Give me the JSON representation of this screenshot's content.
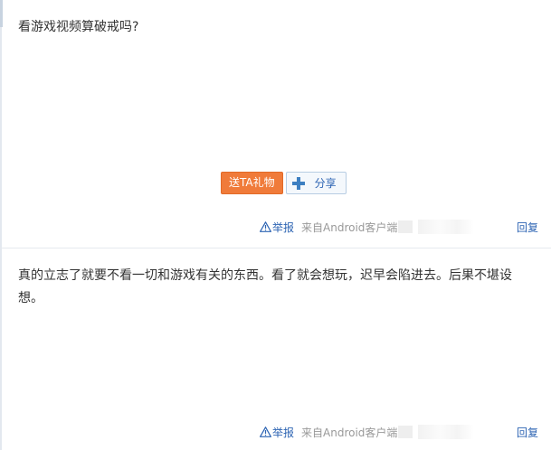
{
  "posts": [
    {
      "content": "看游戏视频算破戒吗?",
      "gift_button": "送TA礼物",
      "share_button": "分享",
      "report": "举报",
      "source": "来自Android客户端",
      "reply": "回复"
    },
    {
      "content": "真的立志了就要不看一切和游戏有关的东西。看了就会想玩，迟早会陷进去。后果不堪设想。",
      "report": "举报",
      "source": "来自Android客户端",
      "reply": "回复"
    }
  ],
  "colors": {
    "gift_button": "#f07b3a",
    "link": "#2d64b3",
    "meta_text": "#999999"
  },
  "icons": {
    "share": "plus-icon",
    "report": "warning-triangle-icon"
  }
}
